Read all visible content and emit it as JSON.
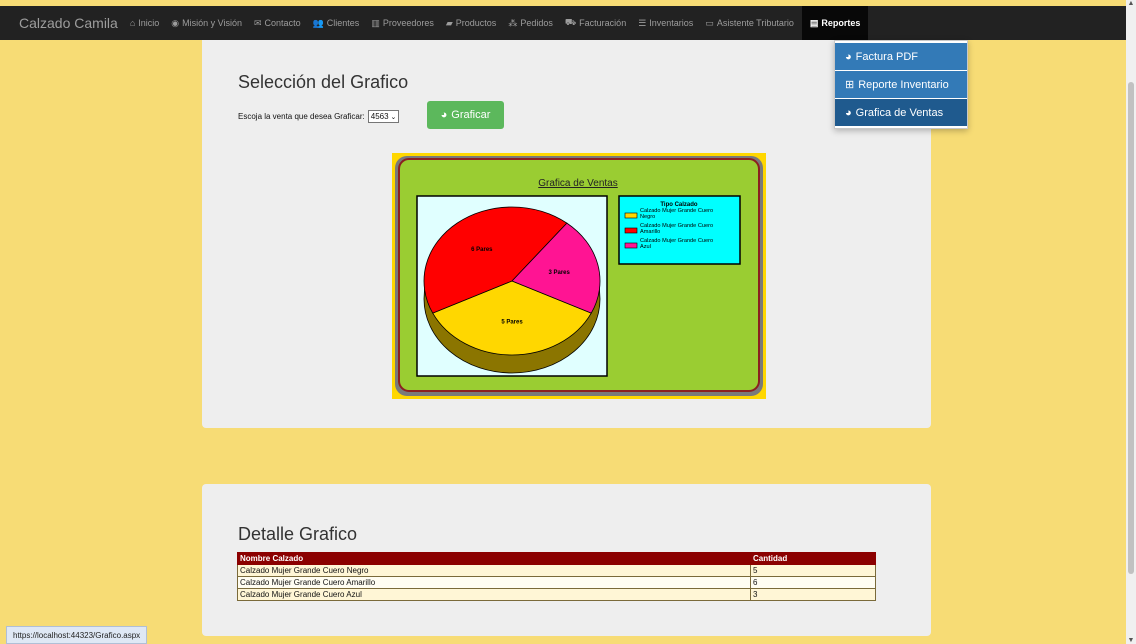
{
  "navbar": {
    "brand": "Calzado Camila",
    "items": [
      {
        "icon": "home-icon",
        "glyph": "⌂",
        "label": "Inicio"
      },
      {
        "icon": "eye-icon",
        "glyph": "◉",
        "label": "Misión y Visión"
      },
      {
        "icon": "envelope-icon",
        "glyph": "✉",
        "label": "Contacto"
      },
      {
        "icon": "users-icon",
        "glyph": "👥",
        "label": "Clientes"
      },
      {
        "icon": "building-icon",
        "glyph": "▥",
        "label": "Proveedores"
      },
      {
        "icon": "book-icon",
        "glyph": "▰",
        "label": "Productos"
      },
      {
        "icon": "boxes-icon",
        "glyph": "⁂",
        "label": "Pedidos"
      },
      {
        "icon": "cart-icon",
        "glyph": "⛟",
        "label": "Facturación"
      },
      {
        "icon": "list-icon",
        "glyph": "☰",
        "label": "Inventarios"
      },
      {
        "icon": "calendar-icon",
        "glyph": "▭",
        "label": "Asistente Tributario"
      },
      {
        "icon": "report-icon",
        "glyph": "▤",
        "label": "Reportes"
      }
    ]
  },
  "dropdown": {
    "items": [
      {
        "icon": "pie-chart-icon",
        "glyph": "◕",
        "label": "Factura PDF"
      },
      {
        "icon": "table-icon",
        "glyph": "⊞",
        "label": "Reporte Inventario"
      },
      {
        "icon": "pie-chart-icon",
        "glyph": "◕",
        "label": "Grafica de Ventas"
      }
    ]
  },
  "seleccion": {
    "title": "Selección del Grafico",
    "prompt": "Escoja la venta que desea Graficar:",
    "selected_sale": "4563",
    "button_label": "Graficar",
    "button_icon": "pie-chart-icon"
  },
  "chart_data": {
    "type": "pie",
    "title": "Grafica de Ventas",
    "legend_title": "Tipo Calzado",
    "legend_placement": "right",
    "categories": [
      "Calzado Mujer Grande Cuero Negro",
      "Calzado Mujer Grande Cuero Amarillo",
      "Calzado Mujer Grande Cuero Azul"
    ],
    "values": [
      5,
      6,
      3
    ],
    "data_labels": [
      "5 Pares",
      "6 Pares",
      "3 Pares"
    ],
    "colors": [
      "#ffd700",
      "#ff0000",
      "#ff1493"
    ]
  },
  "detalle": {
    "title": "Detalle Grafico",
    "headers": [
      "Nombre Calzado",
      "Cantidad"
    ],
    "rows": [
      [
        "Calzado Mujer Grande Cuero Negro",
        "5"
      ],
      [
        "Calzado Mujer Grande Cuero Amarillo",
        "6"
      ],
      [
        "Calzado Mujer Grande Cuero Azul",
        "3"
      ]
    ]
  },
  "status_url": "https://localhost:44323/Grafico.aspx",
  "colors": {
    "page_bg": "#f7dc75",
    "navbar_bg": "#222222",
    "dropdown_item": "#337ab7",
    "button_green": "#5cb85c",
    "table_header": "#8b0000",
    "chart_frame": "#9acd32",
    "legend_bg": "#00ffff"
  }
}
